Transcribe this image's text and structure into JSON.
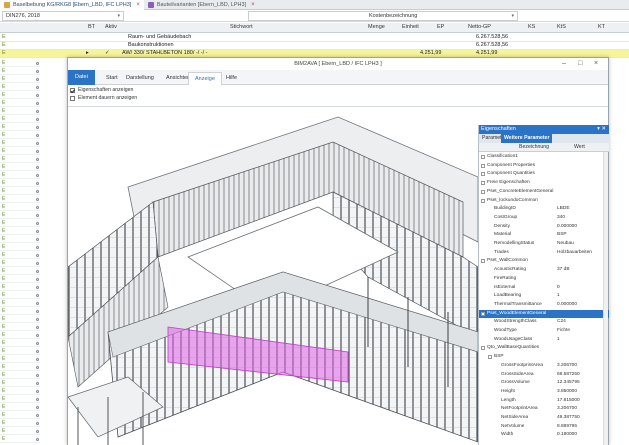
{
  "tabs": [
    {
      "label": "Baselbebung KG/RKG8 [Ebern_LBD, IFC LPH3]",
      "color": "#d9a441",
      "active": true
    },
    {
      "label": "Bauteilvarianten [Ebern_LBD, LPH3]",
      "color": "#8a5cc4",
      "active": false
    }
  ],
  "filter": {
    "left_value": "DIN276, 2018",
    "right_value": "Kostenbezeichnung"
  },
  "grid": {
    "columns": [
      "BT",
      "Aktiv",
      "Stichwort",
      "Menge",
      "Einheit",
      "EP",
      "Netto-GP",
      "KS",
      "KtS",
      "KT"
    ],
    "rows": [
      {
        "stichwort": "Raum- und Gebäudebach",
        "netto": "6.267.528,56",
        "style": "plain"
      },
      {
        "stichwort": "Baukonstruktionen",
        "netto": "6.267.528,56",
        "style": "plain"
      },
      {
        "stichwort": "AW/ 330/ STAHLBETON 180/ -/ -/ -",
        "ep": "4.251,99",
        "netto": "4.251,99",
        "style": "yellow"
      }
    ],
    "left_marker": "E"
  },
  "window": {
    "title": "BIM2AVA [ Ebern_LBD / IFC LPH3 ]",
    "controls": [
      "–",
      "□",
      "×"
    ],
    "ribbon_tabs": [
      "Datei",
      "Start",
      "Darstellung",
      "Ansichten",
      "Anzeige",
      "Hilfe"
    ],
    "selected_ribbon": "Anzeige",
    "options": [
      {
        "label": "Eigenschaften anzeigen",
        "checked": true
      },
      {
        "label": "Element dauern anzeigen",
        "checked": false
      }
    ]
  },
  "properties": {
    "title": "Eigenschaften",
    "pin": "▾ ✕",
    "tabs": [
      "Parameter",
      "Weitere Parameter"
    ],
    "selected_tab": "Weitere Parameter",
    "col_name": "Bezeichnung",
    "col_value": "Wert",
    "items": [
      {
        "indent": 0,
        "toggle": "+",
        "name": "Classification1",
        "value": ""
      },
      {
        "indent": 0,
        "toggle": "+",
        "name": "Component Properties",
        "value": ""
      },
      {
        "indent": 0,
        "toggle": "+",
        "name": "Component Quantities",
        "value": ""
      },
      {
        "indent": 0,
        "toggle": "+",
        "name": "Freie Eigenschaften",
        "value": ""
      },
      {
        "indent": 0,
        "toggle": "+",
        "name": "Pset_ConcreteElementGeneral",
        "value": ""
      },
      {
        "indent": 0,
        "toggle": "-",
        "name": "Pset_lockundoCommon",
        "value": ""
      },
      {
        "indent": 1,
        "toggle": "",
        "name": "BuildingID",
        "value": "LBDE"
      },
      {
        "indent": 1,
        "toggle": "",
        "name": "CostGroup",
        "value": "340"
      },
      {
        "indent": 1,
        "toggle": "",
        "name": "Density",
        "value": "0.000000"
      },
      {
        "indent": 1,
        "toggle": "",
        "name": "Material",
        "value": "BSP"
      },
      {
        "indent": 1,
        "toggle": "",
        "name": "RemodellingStatus",
        "value": "Neubau"
      },
      {
        "indent": 1,
        "toggle": "",
        "name": "Trades",
        "value": "Holzbauarbeiten"
      },
      {
        "indent": 0,
        "toggle": "-",
        "name": "Pset_WallCommon",
        "value": ""
      },
      {
        "indent": 1,
        "toggle": "",
        "name": "AcousticRating",
        "value": "37 dB"
      },
      {
        "indent": 1,
        "toggle": "",
        "name": "FireRating",
        "value": ""
      },
      {
        "indent": 1,
        "toggle": "",
        "name": "IsExternal",
        "value": "0"
      },
      {
        "indent": 1,
        "toggle": "",
        "name": "LoadBearing",
        "value": "1"
      },
      {
        "indent": 1,
        "toggle": "",
        "name": "ThermalTransmittance",
        "value": "0.000000"
      },
      {
        "indent": 0,
        "toggle": "-",
        "name": "Pset_WoodElementGeneral",
        "value": "",
        "highlight": true
      },
      {
        "indent": 1,
        "toggle": "",
        "name": "WoodStrengthClass",
        "value": "C24"
      },
      {
        "indent": 1,
        "toggle": "",
        "name": "WoodType",
        "value": "Fichte"
      },
      {
        "indent": 1,
        "toggle": "",
        "name": "WoodUsageClass",
        "value": "1"
      },
      {
        "indent": 0,
        "toggle": "-",
        "name": "Qto_WallBaseQuantities",
        "value": ""
      },
      {
        "indent": 1,
        "toggle": "-",
        "name": "BSP",
        "value": ""
      },
      {
        "indent": 2,
        "toggle": "",
        "name": "GrossFootprintArea",
        "value": "3.206700"
      },
      {
        "indent": 2,
        "toggle": "",
        "name": "GrossSideArea",
        "value": "68.587250"
      },
      {
        "indent": 2,
        "toggle": "",
        "name": "GrossVolume",
        "value": "12.345795"
      },
      {
        "indent": 2,
        "toggle": "",
        "name": "Height",
        "value": "3.850000"
      },
      {
        "indent": 2,
        "toggle": "",
        "name": "Length",
        "value": "17.815000"
      },
      {
        "indent": 2,
        "toggle": "",
        "name": "NetFootprintArea",
        "value": "3.206700"
      },
      {
        "indent": 2,
        "toggle": "",
        "name": "NetSideArea",
        "value": "49.387750"
      },
      {
        "indent": 2,
        "toggle": "",
        "name": "NetVolume",
        "value": "8.889795"
      },
      {
        "indent": 2,
        "toggle": "",
        "name": "Width",
        "value": "0.180000"
      }
    ]
  },
  "colors": {
    "accent": "#2b73c6",
    "highlight": "#e060e8",
    "row_yellow": "#f6f59a",
    "marker": "#6a8a3a"
  }
}
